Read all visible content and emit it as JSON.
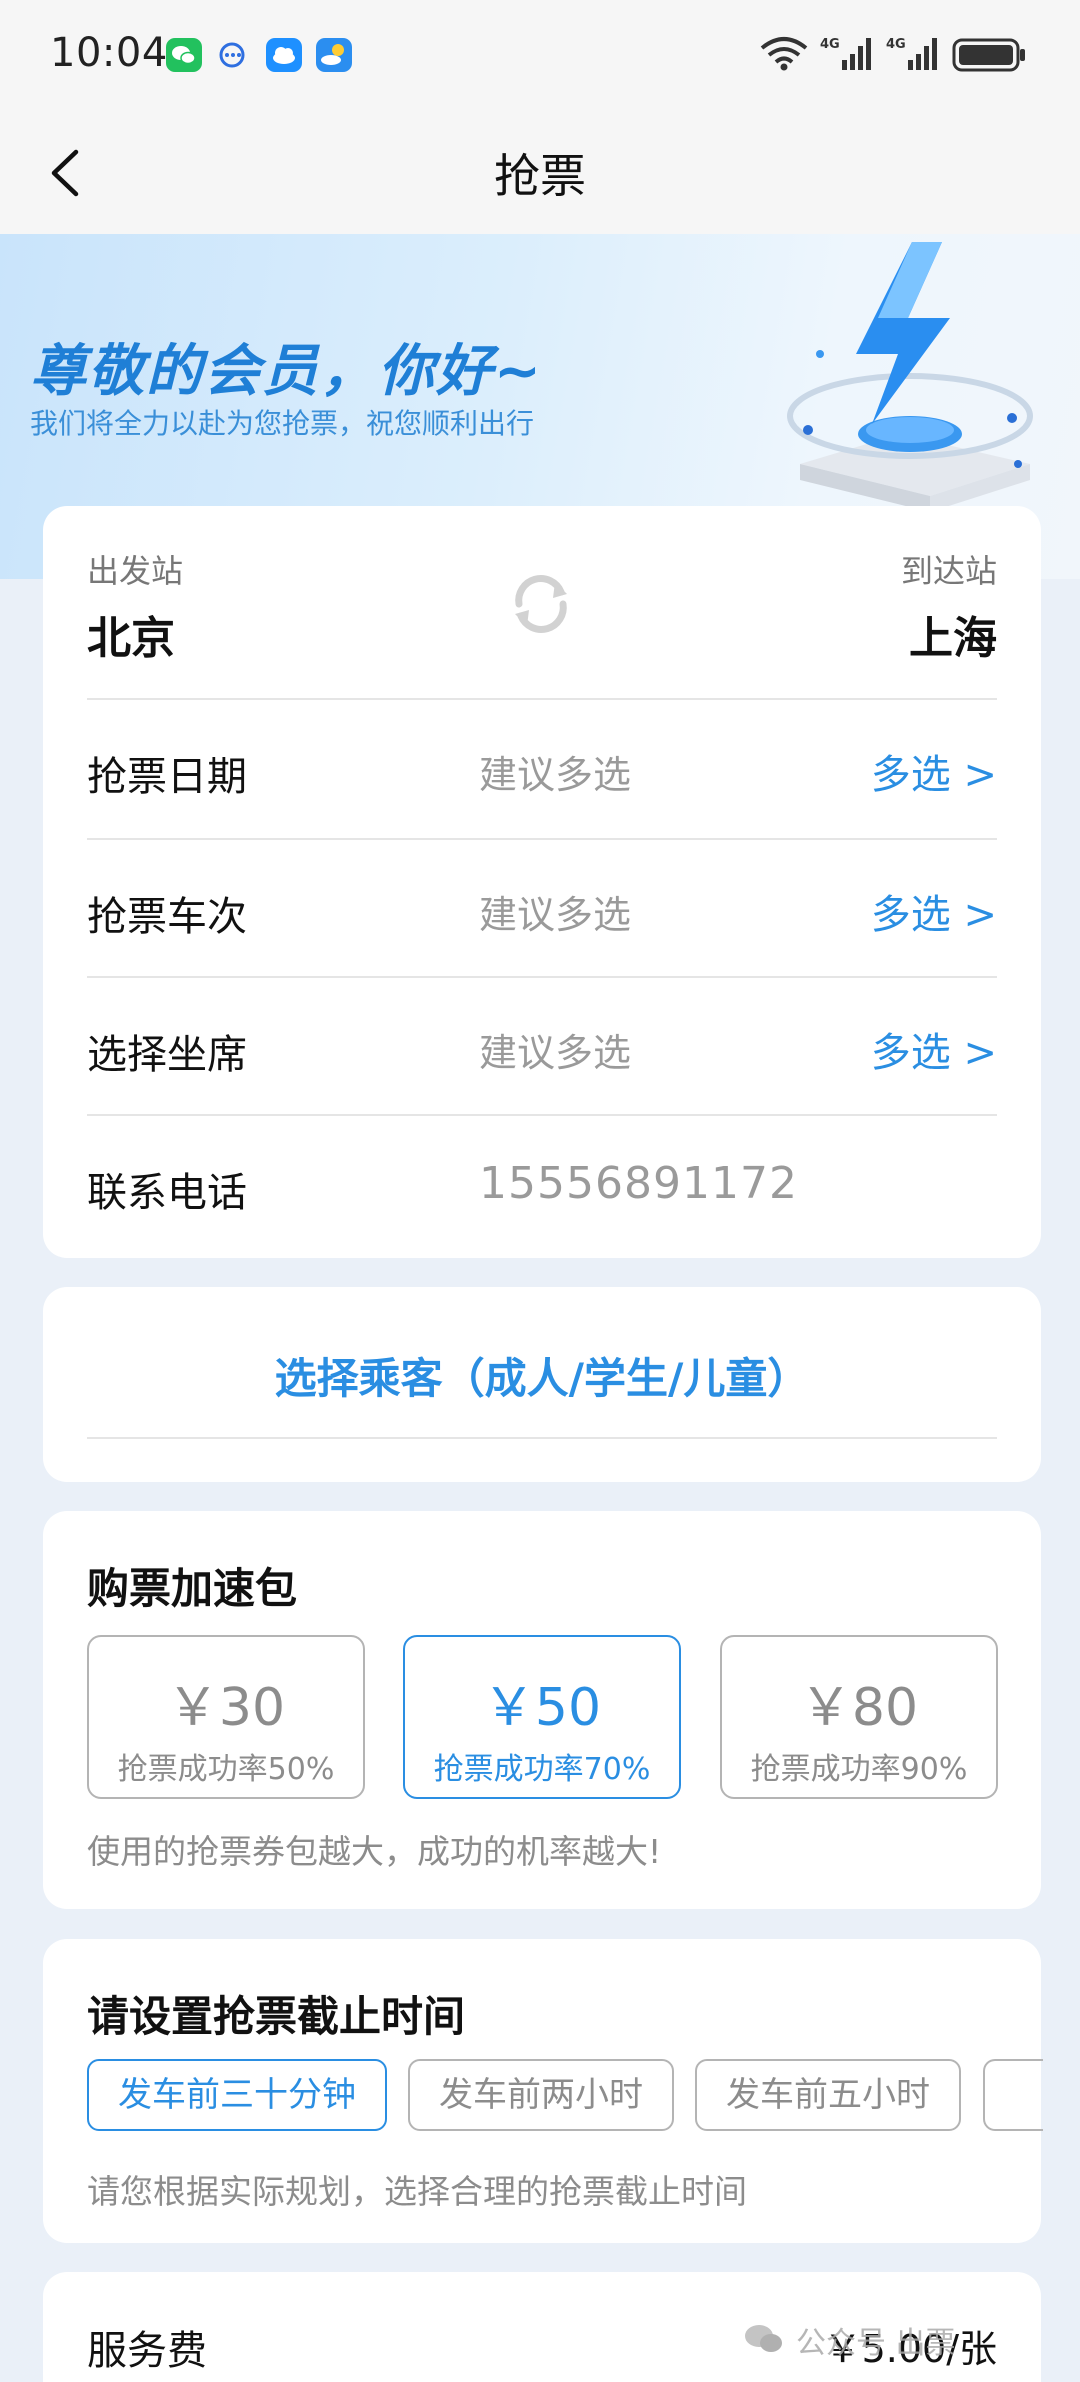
{
  "status_bar": {
    "time": "10:04"
  },
  "nav": {
    "title": "抢票"
  },
  "banner": {
    "title": "尊敬的会员，你好~",
    "subtitle": "我们将全力以赴为您抢票，祝您顺利出行"
  },
  "stations": {
    "from_label": "出发站",
    "from_value": "北京",
    "to_label": "到达站",
    "to_value": "上海"
  },
  "rows": [
    {
      "label": "抢票日期",
      "hint": "建议多选",
      "action": "多选 >"
    },
    {
      "label": "抢票车次",
      "hint": "建议多选",
      "action": "多选 >"
    },
    {
      "label": "选择坐席",
      "hint": "建议多选",
      "action": "多选 >"
    }
  ],
  "contact": {
    "label": "联系电话",
    "value": "15556891172"
  },
  "passenger": {
    "link": "选择乘客（成人/学生/儿童）"
  },
  "boost": {
    "title": "购票加速包",
    "packages": [
      {
        "price": "￥30",
        "rate": "抢票成功率50%"
      },
      {
        "price": "￥50",
        "rate": "抢票成功率70%"
      },
      {
        "price": "￥80",
        "rate": "抢票成功率90%"
      }
    ],
    "selected_index": 1,
    "note": "使用的抢票券包越大，成功的机率越大!"
  },
  "deadline": {
    "title": "请设置抢票截止时间",
    "options": [
      "发车前三十分钟",
      "发车前两小时",
      "发车前五小时"
    ],
    "selected_index": 0,
    "note": "请您根据实际规划，选择合理的抢票截止时间"
  },
  "fee": {
    "label": "服务费",
    "value": "￥5.00/张"
  },
  "watermark": {
    "text": "公众号      出票"
  },
  "colors": {
    "accent": "#2a8ee2",
    "banner_title": "#1f7fd6"
  }
}
